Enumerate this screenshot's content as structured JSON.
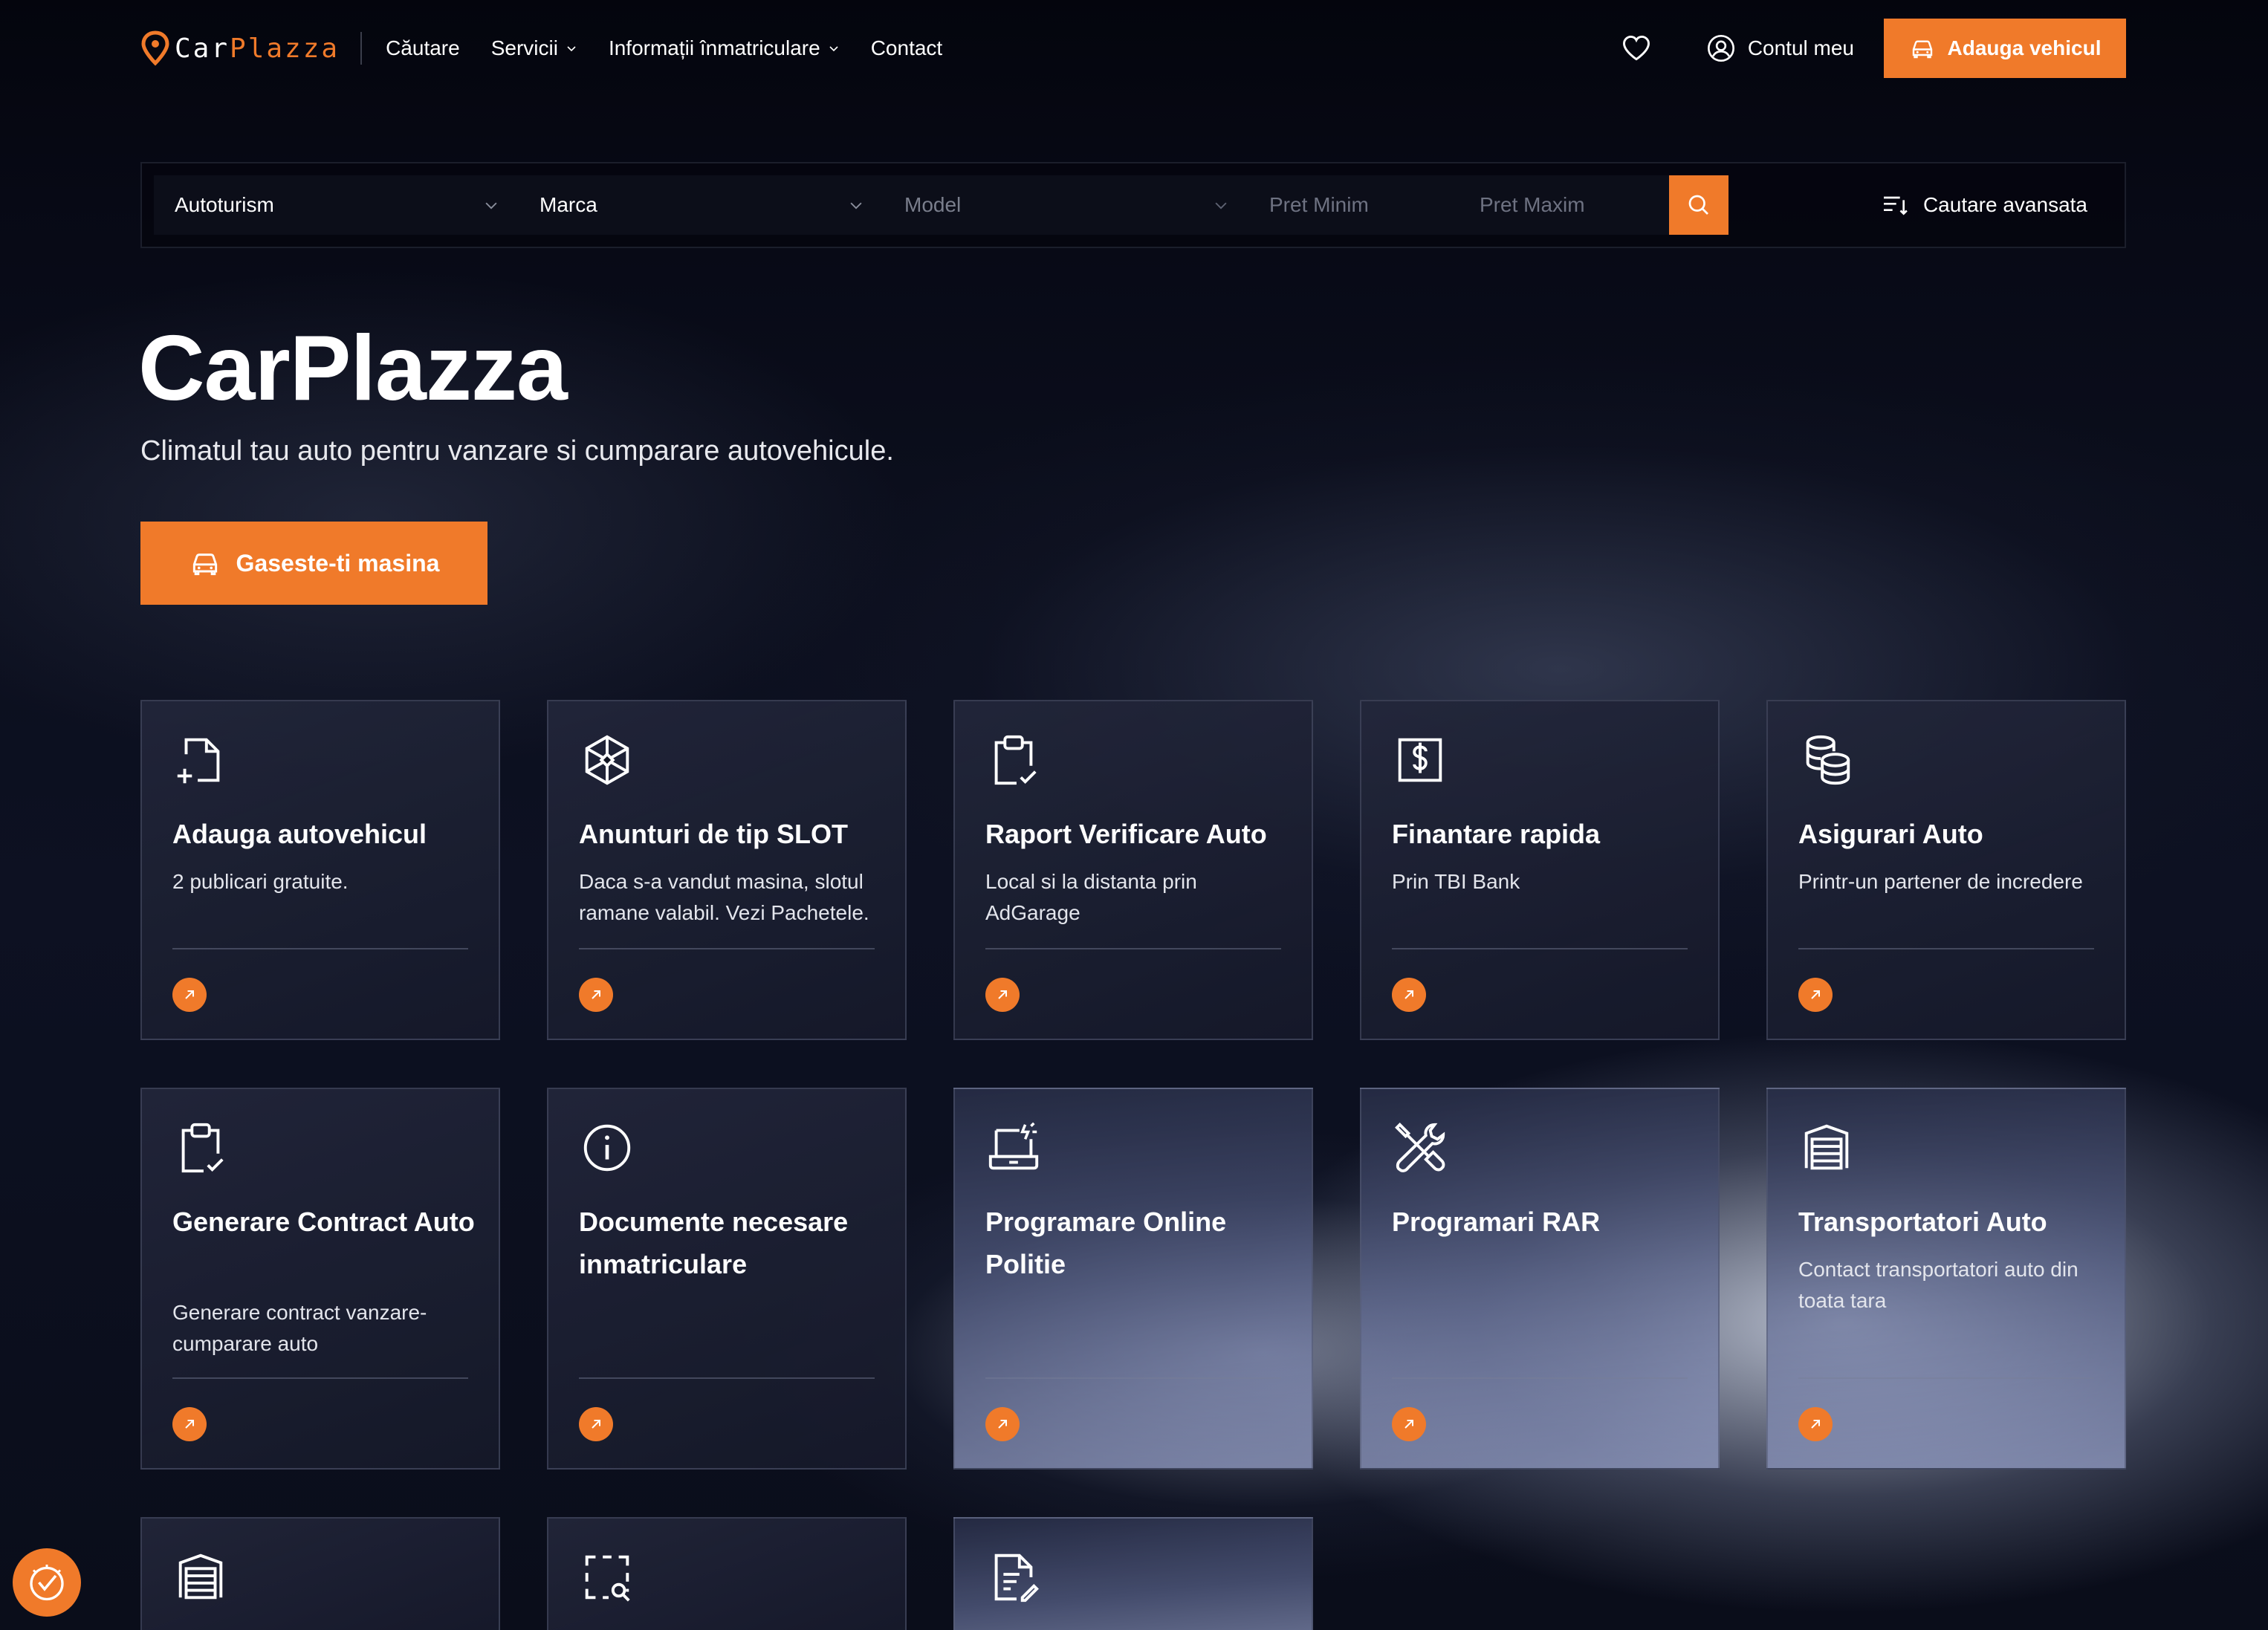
{
  "brand": {
    "part1": "Car",
    "part2": "Plazza",
    "accent": "#f07a2a"
  },
  "nav": {
    "items": [
      {
        "label": "Căutare",
        "has_dropdown": false
      },
      {
        "label": "Servicii",
        "has_dropdown": true
      },
      {
        "label": "Informații înmatriculare",
        "has_dropdown": true
      },
      {
        "label": "Contact",
        "has_dropdown": false
      }
    ],
    "favorites_icon": "heart-icon",
    "account_label": "Contul meu",
    "add_vehicle_label": "Adauga vehicul"
  },
  "search": {
    "category": "Autoturism",
    "make": "Marca",
    "model": "Model",
    "price_min_placeholder": "Pret Minim",
    "price_max_placeholder": "Pret Maxim",
    "advanced_label": "Cautare avansata"
  },
  "hero": {
    "title": "CarPlazza",
    "subtitle": "Climatul tau auto pentru vanzare si cumparare autovehicule.",
    "cta_label": "Gaseste-ti masina"
  },
  "cards": [
    {
      "title": "Adauga autovehicul",
      "desc": "2 publicari gratuite.",
      "icon": "add-document-icon"
    },
    {
      "title": "Anunturi de tip SLOT",
      "desc": "Daca s-a vandut masina, slotul ramane valabil. Vezi Pachetele.",
      "icon": "cube-icon"
    },
    {
      "title": "Raport Verificare Auto",
      "desc": "Local si la distanta prin AdGarage",
      "icon": "clipboard-check-icon"
    },
    {
      "title": "Finantare rapida",
      "desc": "Prin TBI Bank",
      "icon": "dollar-icon"
    },
    {
      "title": "Asigurari Auto",
      "desc": "Printr-un partener de incredere",
      "icon": "coins-icon"
    },
    {
      "title": "Generare Contract Auto",
      "desc": "Generare contract vanzare-cumparare auto",
      "icon": "clipboard-check-icon"
    },
    {
      "title": "Documente necesare inmatriculare",
      "desc": "",
      "icon": "info-icon"
    },
    {
      "title": "Programare Online Politie",
      "desc": "",
      "icon": "laptop-icon"
    },
    {
      "title": "Programari RAR",
      "desc": "",
      "icon": "tools-icon"
    },
    {
      "title": "Transportatori Auto",
      "desc": "Contact transportatori auto din toata tara",
      "icon": "garage-icon"
    },
    {
      "title": "",
      "desc": "",
      "icon": "garage-icon"
    },
    {
      "title": "",
      "desc": "",
      "icon": "scan-search-icon"
    },
    {
      "title": "",
      "desc": "",
      "icon": "document-edit-icon"
    }
  ]
}
